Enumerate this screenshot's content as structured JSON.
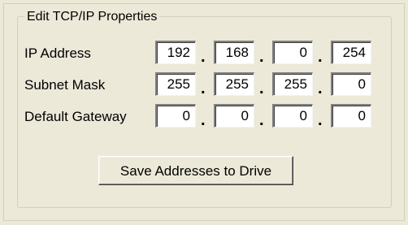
{
  "group": {
    "title": "Edit TCP/IP Properties"
  },
  "rows": [
    {
      "label": "IP Address",
      "octets": [
        "192",
        "168",
        "0",
        "254"
      ]
    },
    {
      "label": "Subnet Mask",
      "octets": [
        "255",
        "255",
        "255",
        "0"
      ]
    },
    {
      "label": "Default Gateway",
      "octets": [
        "0",
        "0",
        "0",
        "0"
      ]
    }
  ],
  "separator": ".",
  "save_button": {
    "label": "Save Addresses to Drive"
  }
}
